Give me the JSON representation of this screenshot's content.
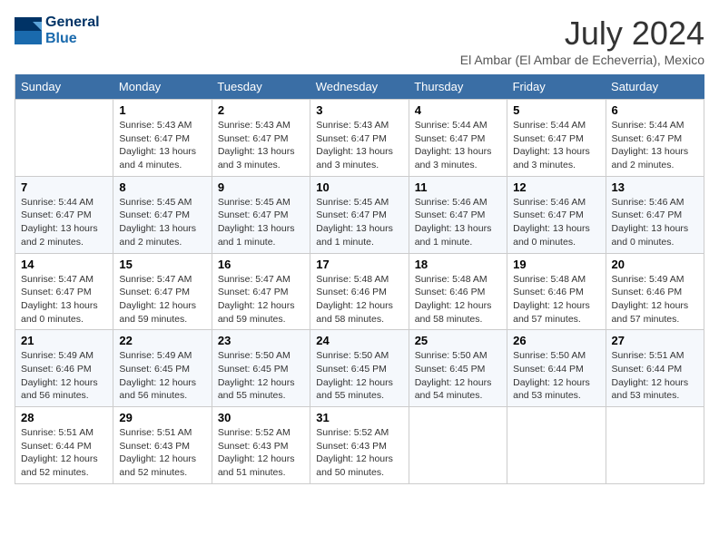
{
  "header": {
    "logo_line1": "General",
    "logo_line2": "Blue",
    "month_year": "July 2024",
    "location": "El Ambar (El Ambar de Echeverria), Mexico"
  },
  "columns": [
    "Sunday",
    "Monday",
    "Tuesday",
    "Wednesday",
    "Thursday",
    "Friday",
    "Saturday"
  ],
  "weeks": [
    [
      {
        "num": "",
        "info": ""
      },
      {
        "num": "1",
        "info": "Sunrise: 5:43 AM\nSunset: 6:47 PM\nDaylight: 13 hours\nand 4 minutes."
      },
      {
        "num": "2",
        "info": "Sunrise: 5:43 AM\nSunset: 6:47 PM\nDaylight: 13 hours\nand 3 minutes."
      },
      {
        "num": "3",
        "info": "Sunrise: 5:43 AM\nSunset: 6:47 PM\nDaylight: 13 hours\nand 3 minutes."
      },
      {
        "num": "4",
        "info": "Sunrise: 5:44 AM\nSunset: 6:47 PM\nDaylight: 13 hours\nand 3 minutes."
      },
      {
        "num": "5",
        "info": "Sunrise: 5:44 AM\nSunset: 6:47 PM\nDaylight: 13 hours\nand 3 minutes."
      },
      {
        "num": "6",
        "info": "Sunrise: 5:44 AM\nSunset: 6:47 PM\nDaylight: 13 hours\nand 2 minutes."
      }
    ],
    [
      {
        "num": "7",
        "info": "Sunrise: 5:44 AM\nSunset: 6:47 PM\nDaylight: 13 hours\nand 2 minutes."
      },
      {
        "num": "8",
        "info": "Sunrise: 5:45 AM\nSunset: 6:47 PM\nDaylight: 13 hours\nand 2 minutes."
      },
      {
        "num": "9",
        "info": "Sunrise: 5:45 AM\nSunset: 6:47 PM\nDaylight: 13 hours\nand 1 minute."
      },
      {
        "num": "10",
        "info": "Sunrise: 5:45 AM\nSunset: 6:47 PM\nDaylight: 13 hours\nand 1 minute."
      },
      {
        "num": "11",
        "info": "Sunrise: 5:46 AM\nSunset: 6:47 PM\nDaylight: 13 hours\nand 1 minute."
      },
      {
        "num": "12",
        "info": "Sunrise: 5:46 AM\nSunset: 6:47 PM\nDaylight: 13 hours\nand 0 minutes."
      },
      {
        "num": "13",
        "info": "Sunrise: 5:46 AM\nSunset: 6:47 PM\nDaylight: 13 hours\nand 0 minutes."
      }
    ],
    [
      {
        "num": "14",
        "info": "Sunrise: 5:47 AM\nSunset: 6:47 PM\nDaylight: 13 hours\nand 0 minutes."
      },
      {
        "num": "15",
        "info": "Sunrise: 5:47 AM\nSunset: 6:47 PM\nDaylight: 12 hours\nand 59 minutes."
      },
      {
        "num": "16",
        "info": "Sunrise: 5:47 AM\nSunset: 6:47 PM\nDaylight: 12 hours\nand 59 minutes."
      },
      {
        "num": "17",
        "info": "Sunrise: 5:48 AM\nSunset: 6:46 PM\nDaylight: 12 hours\nand 58 minutes."
      },
      {
        "num": "18",
        "info": "Sunrise: 5:48 AM\nSunset: 6:46 PM\nDaylight: 12 hours\nand 58 minutes."
      },
      {
        "num": "19",
        "info": "Sunrise: 5:48 AM\nSunset: 6:46 PM\nDaylight: 12 hours\nand 57 minutes."
      },
      {
        "num": "20",
        "info": "Sunrise: 5:49 AM\nSunset: 6:46 PM\nDaylight: 12 hours\nand 57 minutes."
      }
    ],
    [
      {
        "num": "21",
        "info": "Sunrise: 5:49 AM\nSunset: 6:46 PM\nDaylight: 12 hours\nand 56 minutes."
      },
      {
        "num": "22",
        "info": "Sunrise: 5:49 AM\nSunset: 6:45 PM\nDaylight: 12 hours\nand 56 minutes."
      },
      {
        "num": "23",
        "info": "Sunrise: 5:50 AM\nSunset: 6:45 PM\nDaylight: 12 hours\nand 55 minutes."
      },
      {
        "num": "24",
        "info": "Sunrise: 5:50 AM\nSunset: 6:45 PM\nDaylight: 12 hours\nand 55 minutes."
      },
      {
        "num": "25",
        "info": "Sunrise: 5:50 AM\nSunset: 6:45 PM\nDaylight: 12 hours\nand 54 minutes."
      },
      {
        "num": "26",
        "info": "Sunrise: 5:50 AM\nSunset: 6:44 PM\nDaylight: 12 hours\nand 53 minutes."
      },
      {
        "num": "27",
        "info": "Sunrise: 5:51 AM\nSunset: 6:44 PM\nDaylight: 12 hours\nand 53 minutes."
      }
    ],
    [
      {
        "num": "28",
        "info": "Sunrise: 5:51 AM\nSunset: 6:44 PM\nDaylight: 12 hours\nand 52 minutes."
      },
      {
        "num": "29",
        "info": "Sunrise: 5:51 AM\nSunset: 6:43 PM\nDaylight: 12 hours\nand 52 minutes."
      },
      {
        "num": "30",
        "info": "Sunrise: 5:52 AM\nSunset: 6:43 PM\nDaylight: 12 hours\nand 51 minutes."
      },
      {
        "num": "31",
        "info": "Sunrise: 5:52 AM\nSunset: 6:43 PM\nDaylight: 12 hours\nand 50 minutes."
      },
      {
        "num": "",
        "info": ""
      },
      {
        "num": "",
        "info": ""
      },
      {
        "num": "",
        "info": ""
      }
    ]
  ]
}
